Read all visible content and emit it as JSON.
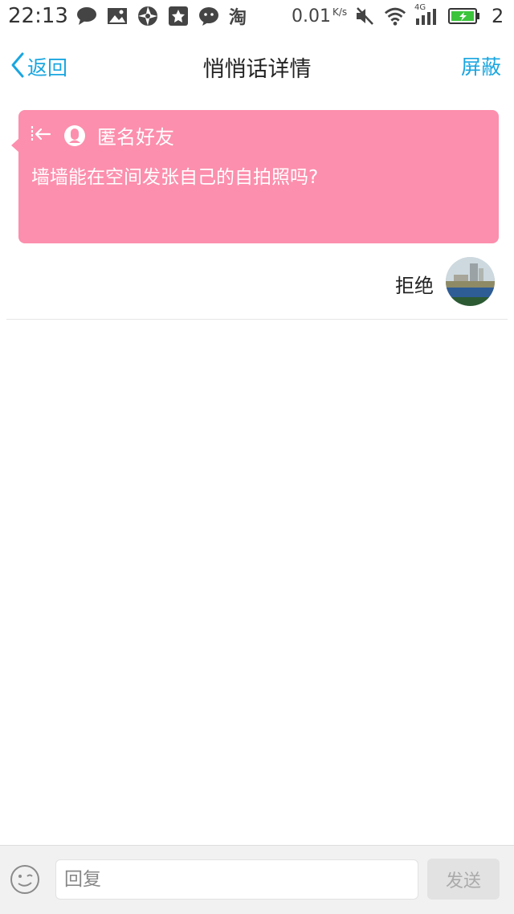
{
  "status_bar": {
    "time": "22:13",
    "net_speed": "0.01",
    "net_unit": "K/s",
    "network_type": "4G",
    "battery_level": "2",
    "notification_icons": [
      "chat-bubble-icon",
      "image-icon",
      "aperture-icon",
      "star-box-icon",
      "wechat-icon",
      "taobao-icon"
    ],
    "system_icons": [
      "mute-icon",
      "wifi-icon",
      "signal-icon",
      "battery-charging-icon"
    ]
  },
  "nav": {
    "back_label": "返回",
    "title": "悄悄话详情",
    "block_label": "屏蔽"
  },
  "message": {
    "sender": "匿名好友",
    "text": "墙墙能在空间发张自己的自拍照吗?",
    "card_color": "#fc8fad"
  },
  "reply": {
    "label": "拒绝"
  },
  "input_bar": {
    "placeholder": "回复",
    "send_label": "发送"
  },
  "colors": {
    "accent": "#1aa6e0",
    "card": "#fc8fad"
  }
}
